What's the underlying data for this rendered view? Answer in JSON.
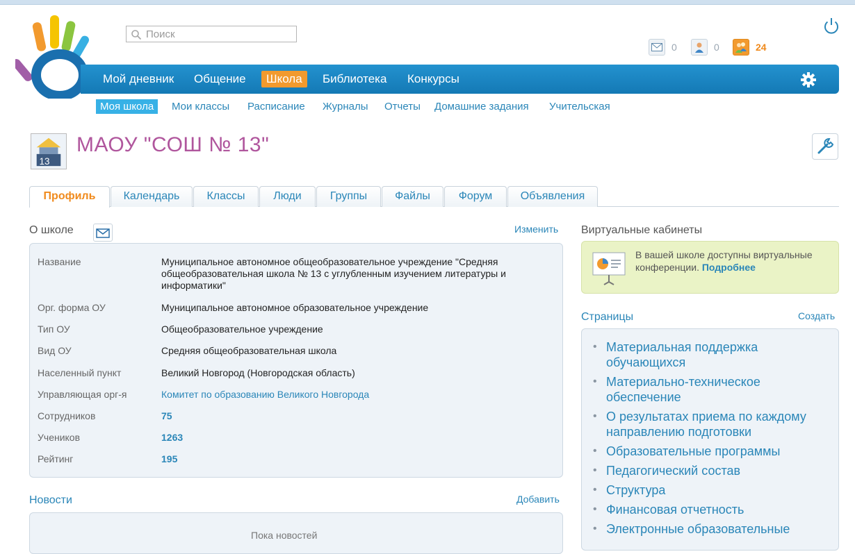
{
  "header": {
    "search_placeholder": "Поиск",
    "counters": {
      "messages": "0",
      "friends": "0",
      "events": "24"
    },
    "icons": [
      "search-icon",
      "envelope-icon",
      "person-icon",
      "people-icon",
      "power-icon",
      "gear-icon"
    ],
    "accent_color": "#1a86c4",
    "active_color": "#f29a2e"
  },
  "mainnav": [
    "Мой дневник",
    "Общение",
    "Школа",
    "Библиотека",
    "Конкурсы"
  ],
  "subnav": [
    "Моя школа",
    "Мои классы",
    "Расписание",
    "Журналы",
    "Отчеты",
    "Домашние задания",
    "Учительская"
  ],
  "school": {
    "title": "МАОУ \"СОШ № 13\""
  },
  "tabs": [
    "Профиль",
    "Календарь",
    "Классы",
    "Люди",
    "Группы",
    "Файлы",
    "Форум",
    "Объявления"
  ],
  "about": {
    "title": "О школе",
    "edit": "Изменить",
    "rows": [
      {
        "label": "Название",
        "value": "Муниципальное автономное общеобразовательное учреждение \"Средняя общеобразовательная школа № 13 с углубленным изучением литературы и информатики\""
      },
      {
        "label": "Орг. форма ОУ",
        "value": "Муниципальное автономное образовательное учреждение"
      },
      {
        "label": "Тип ОУ",
        "value": "Общеобразовательное учреждение"
      },
      {
        "label": "Вид ОУ",
        "value": "Средняя общеобразовательная школа"
      },
      {
        "label": "Населенный пункт",
        "value": "Великий Новгород (Новгородская область)"
      },
      {
        "label": "Управляющая орг-я",
        "value": "Комитет по образованию Великого Новгорода"
      },
      {
        "label": "Сотрудников",
        "value": "75"
      },
      {
        "label": "Учеников",
        "value": "1263"
      },
      {
        "label": "Рейтинг",
        "value": "195"
      }
    ]
  },
  "news": {
    "title": "Новости",
    "add": "Добавить",
    "empty": "Пока новостей"
  },
  "virtual": {
    "title": "Виртуальные кабинеты",
    "text": "В вашей школе доступны виртуальные конференции.",
    "more": "Подробнее"
  },
  "pages": {
    "title": "Страницы",
    "create": "Создать",
    "items": [
      "Материальная поддержка обучающихся",
      "Материально-техническое обеспечение",
      "О результатах приема по каждому направлению подготовки",
      "Образовательные программы",
      "Педагогический состав",
      "Структура",
      "Финансовая отчетность",
      "Электронные образовательные"
    ]
  }
}
